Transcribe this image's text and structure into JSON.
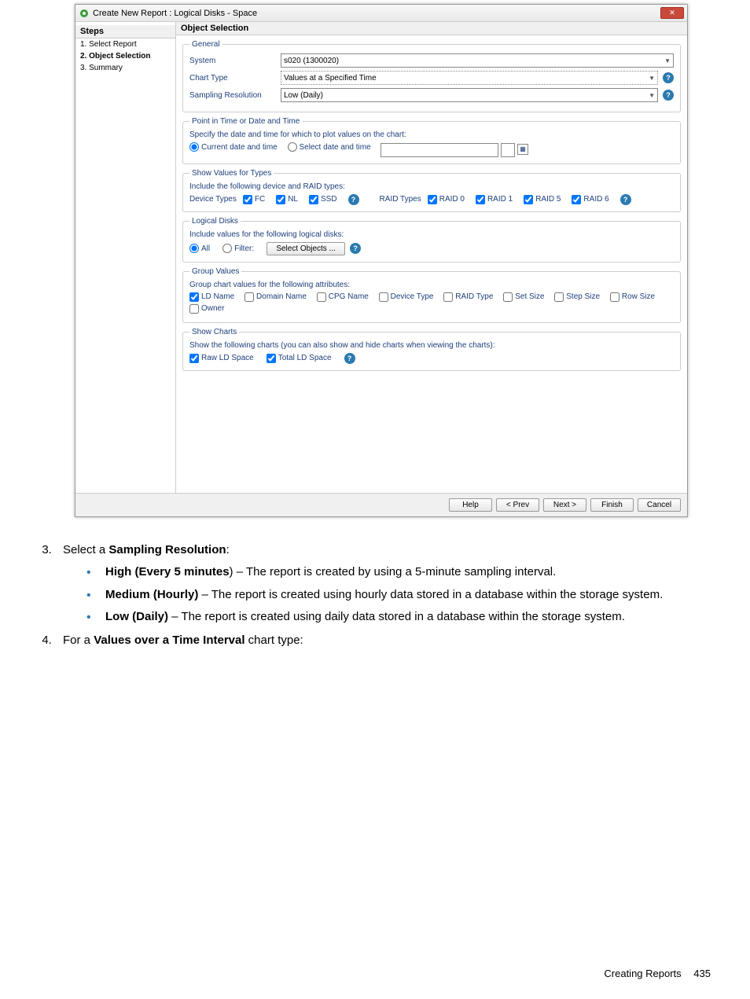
{
  "dialog": {
    "title": "Create New Report : Logical Disks - Space",
    "close_x": "✕"
  },
  "steps": {
    "header": "Steps",
    "items": [
      "1. Select Report",
      "2. Object Selection",
      "3. Summary"
    ]
  },
  "content": {
    "header": "Object Selection"
  },
  "general": {
    "legend": "General",
    "system_label": "System",
    "system_value": "s020 (1300020)",
    "chart_label": "Chart Type",
    "chart_value": "Values at a Specified Time",
    "sr_label": "Sampling Resolution",
    "sr_value": "Low (Daily)"
  },
  "pit": {
    "legend": "Point in Time or Date and Time",
    "desc": "Specify the date and time for which to plot values on the chart:",
    "r1": "Current date and time",
    "r2": "Select date and time"
  },
  "svt": {
    "legend": "Show Values for Types",
    "desc": "Include the following device and RAID types:",
    "dev_label": "Device Types",
    "fc": "FC",
    "nl": "NL",
    "ssd": "SSD",
    "raid_label": "RAID Types",
    "r0": "RAID 0",
    "r1": "RAID 1",
    "r5": "RAID 5",
    "r6": "RAID 6"
  },
  "ld": {
    "legend": "Logical Disks",
    "desc": "Include values for the following logical disks:",
    "all": "All",
    "filter": "Filter:",
    "btn": "Select Objects ..."
  },
  "gv": {
    "legend": "Group Values",
    "desc": "Group chart values for the following attributes:",
    "ldname": "LD Name",
    "domain": "Domain Name",
    "cpg": "CPG Name",
    "devtype": "Device Type",
    "raidtype": "RAID Type",
    "setsize": "Set Size",
    "stepsize": "Step Size",
    "rowsize": "Row Size",
    "owner": "Owner"
  },
  "sc": {
    "legend": "Show Charts",
    "desc": "Show the following charts (you can also show and hide charts when viewing the charts):",
    "raw": "Raw LD Space",
    "total": "Total LD Space"
  },
  "buttons": {
    "help": "Help",
    "prev": "< Prev",
    "next": "Next >",
    "finish": "Finish",
    "cancel": "Cancel"
  },
  "doc": {
    "li3": "Select a ",
    "li3b": "Sampling Resolution",
    "li3c": ":",
    "b1a": "High (Every 5 minutes",
    "b1b": ") – The report is created by using a 5-minute sampling interval.",
    "b2a": "Medium (Hourly)",
    "b2b": " – The report is created using hourly data stored in a database within the storage system.",
    "b3a": "Low (Daily)",
    "b3b": " – The report is created using daily data stored in a database within the storage system.",
    "li4a": "For a ",
    "li4b": "Values over a Time Interval",
    "li4c": " chart type:"
  },
  "footer": {
    "label": "Creating Reports",
    "page": "435"
  }
}
